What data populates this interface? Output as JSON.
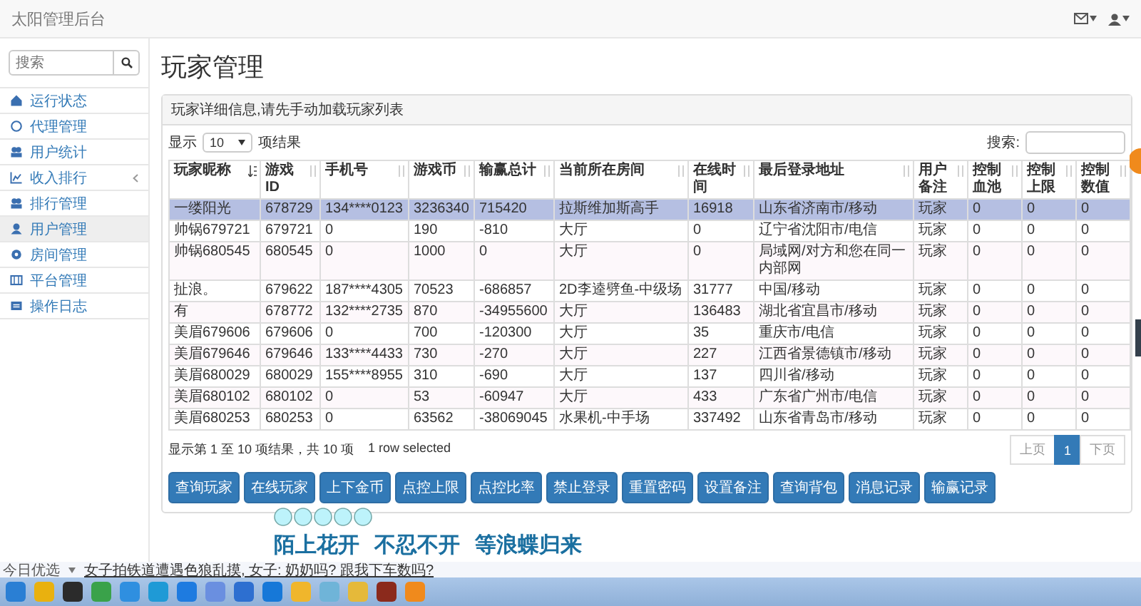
{
  "app": {
    "title": "太阳管理后台"
  },
  "sidebar": {
    "search": {
      "placeholder": "搜索"
    },
    "items": [
      {
        "label": "运行状态",
        "selected": false,
        "has_submenu": false
      },
      {
        "label": "代理管理",
        "selected": false,
        "has_submenu": false
      },
      {
        "label": "用户统计",
        "selected": false,
        "has_submenu": false
      },
      {
        "label": "收入排行",
        "selected": false,
        "has_submenu": true
      },
      {
        "label": "排行管理",
        "selected": false,
        "has_submenu": false
      },
      {
        "label": "用户管理",
        "selected": true,
        "has_submenu": false
      },
      {
        "label": "房间管理",
        "selected": false,
        "has_submenu": false
      },
      {
        "label": "平台管理",
        "selected": false,
        "has_submenu": false
      },
      {
        "label": "操作日志",
        "selected": false,
        "has_submenu": false
      }
    ]
  },
  "page_title": "玩家管理",
  "panel": {
    "heading": "玩家详细信息,请先手动加载玩家列表",
    "length_before": "显示",
    "page_length": "10",
    "length_after": "项结果",
    "search_label": "搜索:",
    "columns": [
      {
        "label": "玩家昵称",
        "sorted": true
      },
      {
        "label": "游戏ID",
        "sorted": false
      },
      {
        "label": "手机号",
        "sorted": false
      },
      {
        "label": "游戏币",
        "sorted": false
      },
      {
        "label": "输赢总计",
        "sorted": false
      },
      {
        "label": "当前所在房间",
        "sorted": false
      },
      {
        "label": "在线时间",
        "sorted": false
      },
      {
        "label": "最后登录地址",
        "sorted": false
      },
      {
        "label": "用户备注",
        "sorted": false
      },
      {
        "label": "控制血池",
        "sorted": false
      },
      {
        "label": "控制上限",
        "sorted": false
      },
      {
        "label": "控制数值",
        "sorted": false
      }
    ],
    "rows": [
      {
        "selected": true,
        "cells": [
          "一缕阳光",
          "678729",
          "134****0123",
          "3236340",
          "715420",
          "拉斯维加斯高手",
          "16918",
          "山东省济南市/移动",
          "玩家",
          "0",
          "0",
          "0"
        ]
      },
      {
        "selected": false,
        "cells": [
          "帅锅679721",
          "679721",
          "0",
          "190",
          "-810",
          "大厅",
          "0",
          "辽宁省沈阳市/电信",
          "玩家",
          "0",
          "0",
          "0"
        ]
      },
      {
        "selected": false,
        "cells": [
          "帅锅680545",
          "680545",
          "0",
          "1000",
          "0",
          "大厅",
          "0",
          "局域网/对方和您在同一内部网",
          "玩家",
          "0",
          "0",
          "0"
        ]
      },
      {
        "selected": false,
        "cells": [
          "扯浪。",
          "679622",
          "187****4305",
          "70523",
          "-686857",
          "2D李逵劈鱼-中级场",
          "31777",
          "中国/移动",
          "玩家",
          "0",
          "0",
          "0"
        ]
      },
      {
        "selected": false,
        "cells": [
          "有",
          "678772",
          "132****2735",
          "870",
          "-34955600",
          "大厅",
          "136483",
          "湖北省宜昌市/移动",
          "玩家",
          "0",
          "0",
          "0"
        ]
      },
      {
        "selected": false,
        "cells": [
          "美眉679606",
          "679606",
          "0",
          "700",
          "-120300",
          "大厅",
          "35",
          "重庆市/电信",
          "玩家",
          "0",
          "0",
          "0"
        ]
      },
      {
        "selected": false,
        "cells": [
          "美眉679646",
          "679646",
          "133****4433",
          "730",
          "-270",
          "大厅",
          "227",
          "江西省景德镇市/移动",
          "玩家",
          "0",
          "0",
          "0"
        ]
      },
      {
        "selected": false,
        "cells": [
          "美眉680029",
          "680029",
          "155****8955",
          "310",
          "-690",
          "大厅",
          "137",
          "四川省/移动",
          "玩家",
          "0",
          "0",
          "0"
        ]
      },
      {
        "selected": false,
        "cells": [
          "美眉680102",
          "680102",
          "0",
          "53",
          "-60947",
          "大厅",
          "433",
          "广东省广州市/电信",
          "玩家",
          "0",
          "0",
          "0"
        ]
      },
      {
        "selected": false,
        "cells": [
          "美眉680253",
          "680253",
          "0",
          "63562",
          "-38069045",
          "水果机-中手场",
          "337492",
          "山东省青岛市/移动",
          "玩家",
          "0",
          "0",
          "0"
        ]
      }
    ],
    "info": "显示第 1 至 10 项结果，共 10 项",
    "selection_info": "1 row selected",
    "pagination": [
      {
        "label": "上页",
        "selected": false,
        "disabled": true
      },
      {
        "label": "1",
        "selected": true,
        "disabled": false
      },
      {
        "label": "下页",
        "selected": false,
        "disabled": true
      }
    ],
    "actions": [
      "查询玩家",
      "在线玩家",
      "上下金币",
      "点控上限",
      "点控比率",
      "禁止登录",
      "重置密码",
      "设置备注",
      "查询背包",
      "消息记录",
      "输赢记录"
    ]
  },
  "lyrics": {
    "text": "陌上花开  不忍不开  等浪蝶归来"
  },
  "ticker": {
    "label": "今日优选",
    "headline": "女子拍铁道遭遇色狼乱摸, 女子: 奶奶吗? 跟我下车数吗?"
  }
}
